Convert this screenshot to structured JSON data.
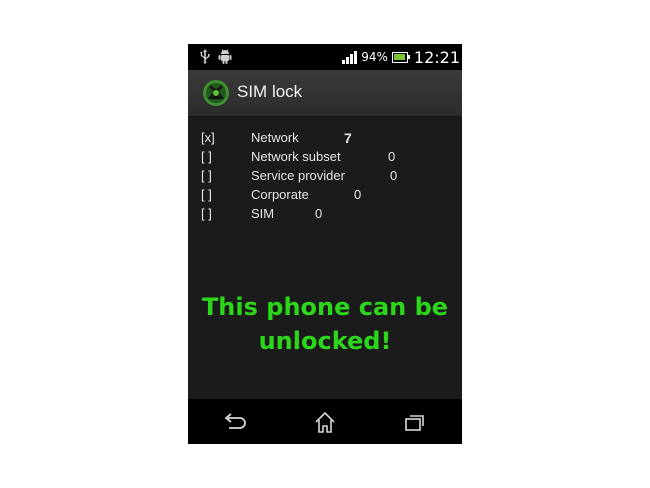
{
  "status_bar": {
    "battery_percent": "94%",
    "time": "12:21",
    "left_icons": [
      "usb-icon",
      "android-icon"
    ],
    "right_icons": [
      "signal-icon",
      "battery-icon"
    ]
  },
  "app": {
    "title": "SIM lock",
    "icon": "sim-lock-app-icon"
  },
  "locks": [
    {
      "check": "[x]",
      "label": "Network",
      "count": "7"
    },
    {
      "check": "[ ]",
      "label": "Network subset",
      "count": "0"
    },
    {
      "check": "[ ]",
      "label": "Service provider",
      "count": "0"
    },
    {
      "check": "[ ]",
      "label": "Corporate",
      "count": "0"
    },
    {
      "check": "[ ]",
      "label": "SIM",
      "count": "0"
    }
  ],
  "message": {
    "line1": "This phone can be",
    "line2": "unlocked!",
    "color": "#2cd61a"
  },
  "nav_bar": {
    "buttons": [
      "back-icon",
      "home-icon",
      "recent-apps-icon"
    ]
  }
}
